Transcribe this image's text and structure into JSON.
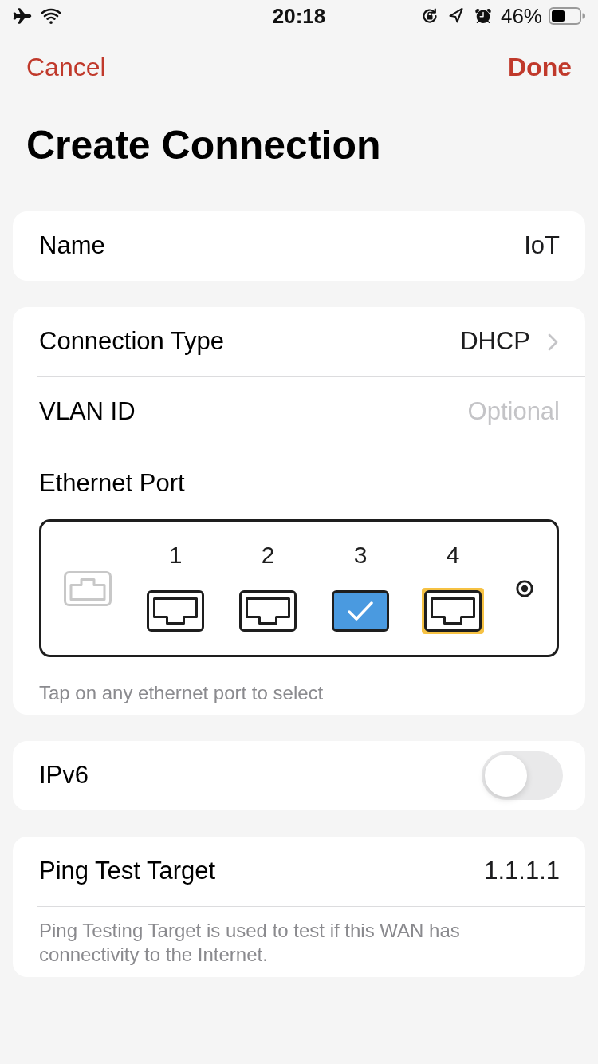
{
  "status_bar": {
    "time": "20:18",
    "battery": "46%"
  },
  "nav": {
    "cancel": "Cancel",
    "done": "Done"
  },
  "title": "Create Connection",
  "sections": [
    {
      "rows": [
        {
          "kind": "value",
          "label": "Name",
          "value": "IoT"
        }
      ]
    },
    {
      "rows": [
        {
          "kind": "link",
          "label": "Connection Type",
          "value": "DHCP"
        },
        {
          "kind": "input",
          "label": "VLAN ID",
          "placeholder": "Optional"
        },
        {
          "kind": "ports",
          "label": "Ethernet Port",
          "ports": [
            {
              "label": "1",
              "selected": false,
              "highlighted": false
            },
            {
              "label": "2",
              "selected": false,
              "highlighted": false
            },
            {
              "label": "3",
              "selected": true,
              "highlighted": false
            },
            {
              "label": "4",
              "selected": false,
              "highlighted": true
            }
          ],
          "hint": "Tap on any ethernet port to select"
        }
      ]
    },
    {
      "rows": [
        {
          "kind": "toggle",
          "label": "IPv6",
          "on": false
        }
      ]
    },
    {
      "rows": [
        {
          "kind": "value",
          "label": "Ping Test Target",
          "value": "1.1.1.1"
        }
      ],
      "footer": "Ping Testing Target is used to test if this WAN has connectivity to the Internet."
    }
  ]
}
